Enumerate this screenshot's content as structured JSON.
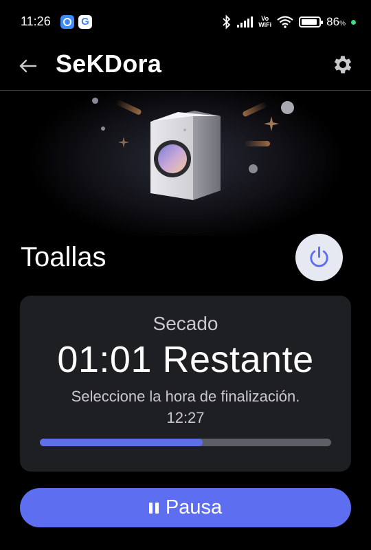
{
  "status_bar": {
    "time": "11:26",
    "network": "VoWiFi",
    "battery_percent": "86",
    "battery_unit": "%"
  },
  "app_bar": {
    "title": "SeKDora",
    "back_icon": "arrow-left-icon",
    "settings_icon": "gear-icon"
  },
  "device": {
    "course": "Toallas",
    "power_icon": "power-icon"
  },
  "status_card": {
    "mode": "Secado",
    "remaining": "01:01 Restante",
    "select_finish_label": "Seleccione la hora de finalización.",
    "finish_time": "12:27",
    "progress_fraction": 0.56
  },
  "actions": {
    "pause_label": "Pausa",
    "pause_icon": "pause-icon"
  },
  "colors": {
    "accent": "#5e6ef0",
    "card_bg": "#1e1f22",
    "background": "#000000"
  }
}
